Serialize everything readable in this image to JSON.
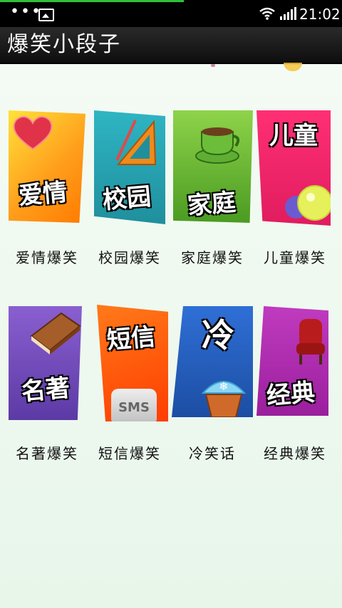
{
  "status_bar": {
    "time": "21:02",
    "dots": "•••"
  },
  "app": {
    "title": "爆笑小段子"
  },
  "categories": [
    {
      "tile_label": "爱情",
      "caption": "爱情爆笑"
    },
    {
      "tile_label": "校园",
      "caption": "校园爆笑"
    },
    {
      "tile_label": "家庭",
      "caption": "家庭爆笑"
    },
    {
      "tile_label": "儿童",
      "caption": "儿童爆笑"
    },
    {
      "tile_label": "名著",
      "caption": "名著爆笑"
    },
    {
      "tile_label": "短信",
      "caption": "短信爆笑",
      "badge": "SMS"
    },
    {
      "tile_label": "冷",
      "caption": "冷笑话"
    },
    {
      "tile_label": "经典",
      "caption": "经典爆笑"
    }
  ]
}
